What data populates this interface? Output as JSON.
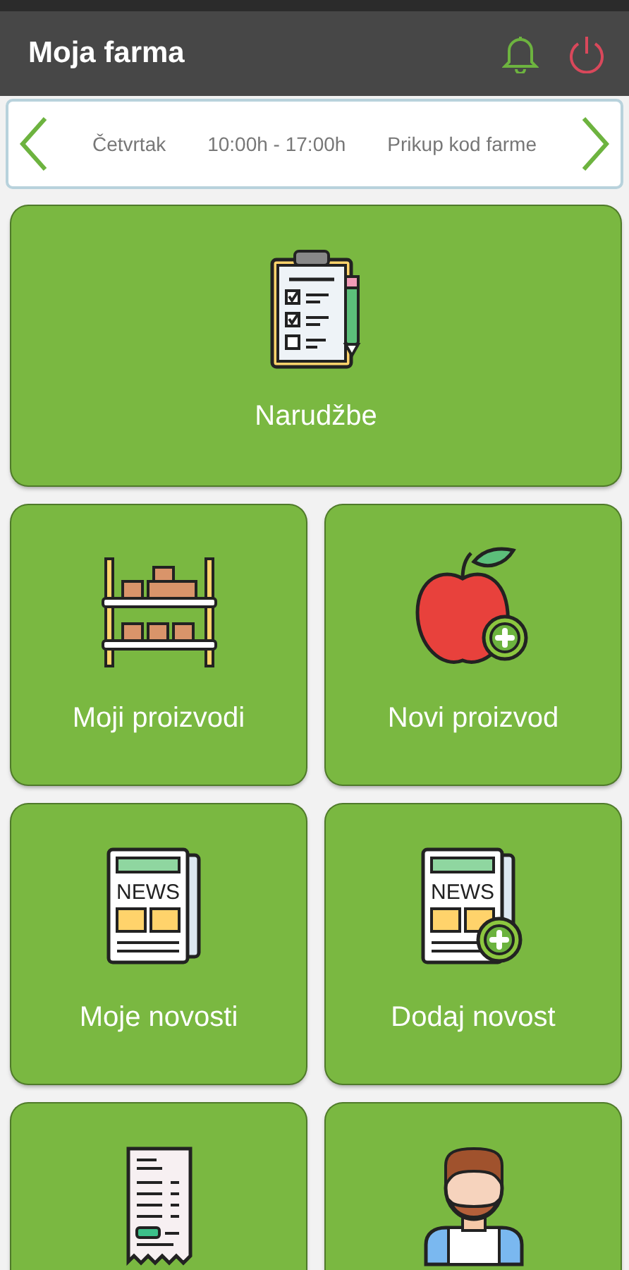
{
  "app_bar": {
    "title": "Moja farma"
  },
  "schedule": {
    "day": "Četvrtak",
    "hours": "10:00h - 17:00h",
    "pickup": "Prikup kod farme"
  },
  "tiles": [
    {
      "kind": "clipboard",
      "label": "Narudžbe",
      "wide": true
    },
    {
      "kind": "shelf",
      "label": "Moji proizvodi",
      "wide": false
    },
    {
      "kind": "apple-plus",
      "label": "Novi proizvod",
      "wide": false
    },
    {
      "kind": "news",
      "label": "Moje novosti",
      "icon_text": "NEWS",
      "wide": false
    },
    {
      "kind": "news-plus",
      "label": "Dodaj novost",
      "icon_text": "NEWS",
      "wide": false
    },
    {
      "kind": "receipt",
      "wide": false
    },
    {
      "kind": "person",
      "wide": false
    }
  ]
}
